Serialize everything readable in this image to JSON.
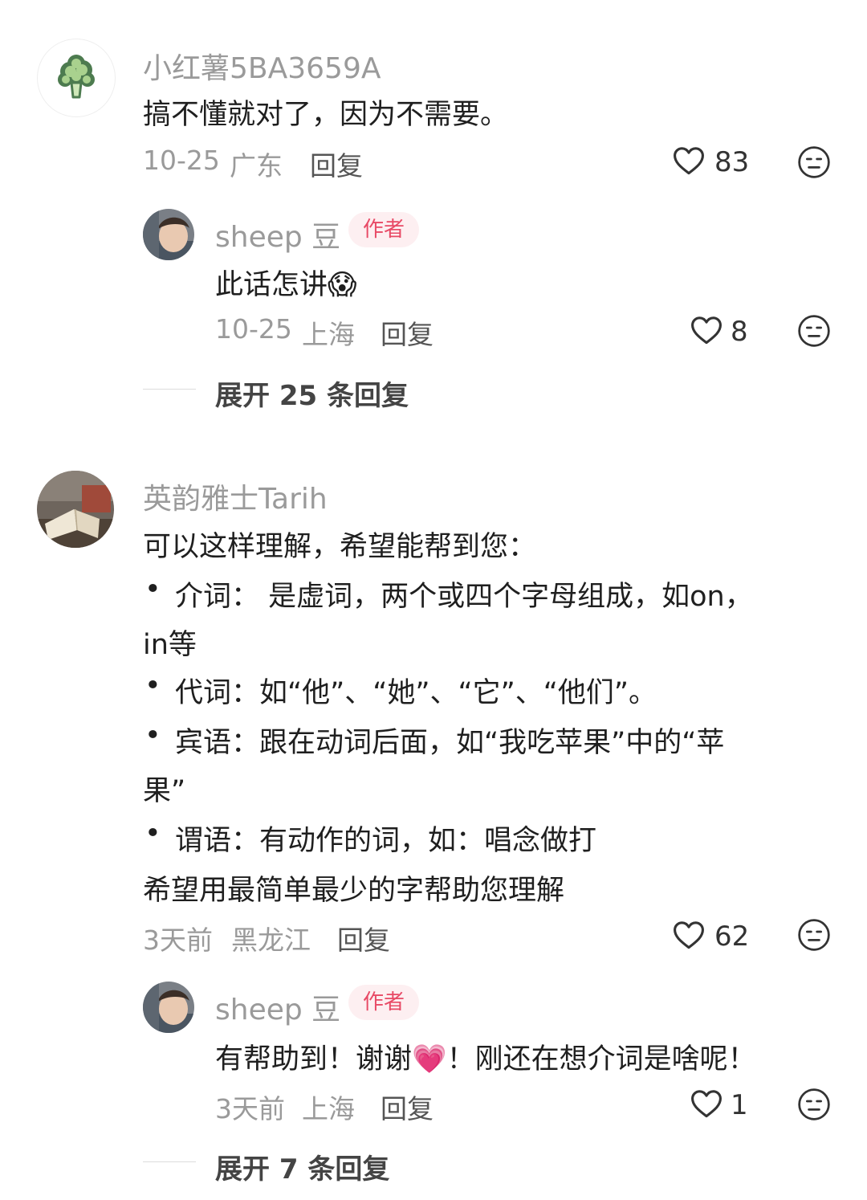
{
  "comments": [
    {
      "user": "小红薯5BA3659A",
      "text": "搞不懂就对了，因为不需要。",
      "date": "10-25",
      "location": "广东",
      "reply_label": "回复",
      "likes": "83",
      "replies": [
        {
          "user": "sheep 豆",
          "badge": "作者",
          "text": "此话怎讲",
          "emoji": "😱",
          "date": "10-25",
          "location": "上海",
          "reply_label": "回复",
          "likes": "8"
        }
      ],
      "expand_label": "展开 25 条回复"
    },
    {
      "user": "英韵雅士Tarih",
      "lines": [
        "可以这样理解，希望能帮到您：",
        "介词：  是虚词，两个或四个字母组成，如on，",
        "in等",
        "代词：如“他”、“她”、“它”、“他们”。",
        "宾语：跟在动词后面，如“我吃苹果”中的“苹",
        "果”",
        "谓语：有动作的词，如：唱念做打",
        "希望用最简单最少的字帮助您理解"
      ],
      "bullet": "•",
      "date": "3天前",
      "location": "黑龙江",
      "reply_label": "回复",
      "likes": "62",
      "replies": [
        {
          "user": "sheep 豆",
          "badge": "作者",
          "text_before": "有帮助到！谢谢",
          "emoji": "💗",
          "text_after": "！刚还在想介词是啥呢！",
          "date": "3天前",
          "location": "上海",
          "reply_label": "回复",
          "likes": "1"
        }
      ],
      "expand_label": "展开 7 条回复"
    }
  ],
  "icons": {
    "like": "heart-outline-icon",
    "dislike": "unamused-face-icon"
  }
}
